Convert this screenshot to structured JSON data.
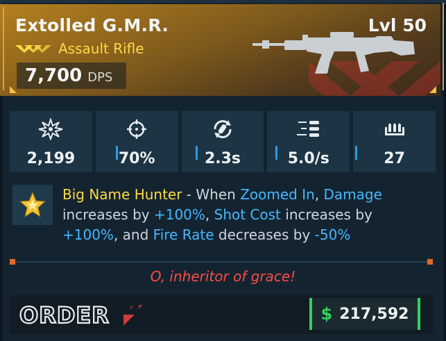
{
  "item": {
    "name": "Extolled G.M.R.",
    "level": "Lvl 50",
    "type": "Assault Rifle",
    "rarity_icon": "triple-chevron-rarity-icon",
    "dps_value": "7,700",
    "dps_unit": "DPS",
    "image_icon": "assault-rifle-silhouette"
  },
  "stats": [
    {
      "icon": "damage-burst-icon",
      "value": "2,199"
    },
    {
      "icon": "crosshair-accuracy-icon",
      "value": "70%"
    },
    {
      "icon": "reload-icon",
      "value": "2.3s"
    },
    {
      "icon": "fire-rate-bullets-icon",
      "value": "5.0/s"
    },
    {
      "icon": "magazine-icon",
      "value": "27"
    }
  ],
  "perk": {
    "icon": "star-perk-icon",
    "name": "Big Name Hunter",
    "sep": " - When ",
    "kw1": "Zoomed In",
    "t1": ", ",
    "kw2": "Damage",
    "t2": " increases by ",
    "kw3": "+100%",
    "t3": ", ",
    "kw4": "Shot Cost",
    "t4": " increases by ",
    "kw5": "+100%",
    "t5": ", and ",
    "kw6": "Fire Rate",
    "t6": " decreases by ",
    "kw7": "-50%"
  },
  "flavor_text": "O, inheritor of grace!",
  "footer": {
    "manufacturer_logo": "ORDER",
    "currency_icon": "$",
    "price": "217,592"
  },
  "colors": {
    "rarity_gold": "#ffd945",
    "keyword_blue": "#49b6ff",
    "flavor_red": "#ff4a4a",
    "price_green": "#35d15a"
  }
}
